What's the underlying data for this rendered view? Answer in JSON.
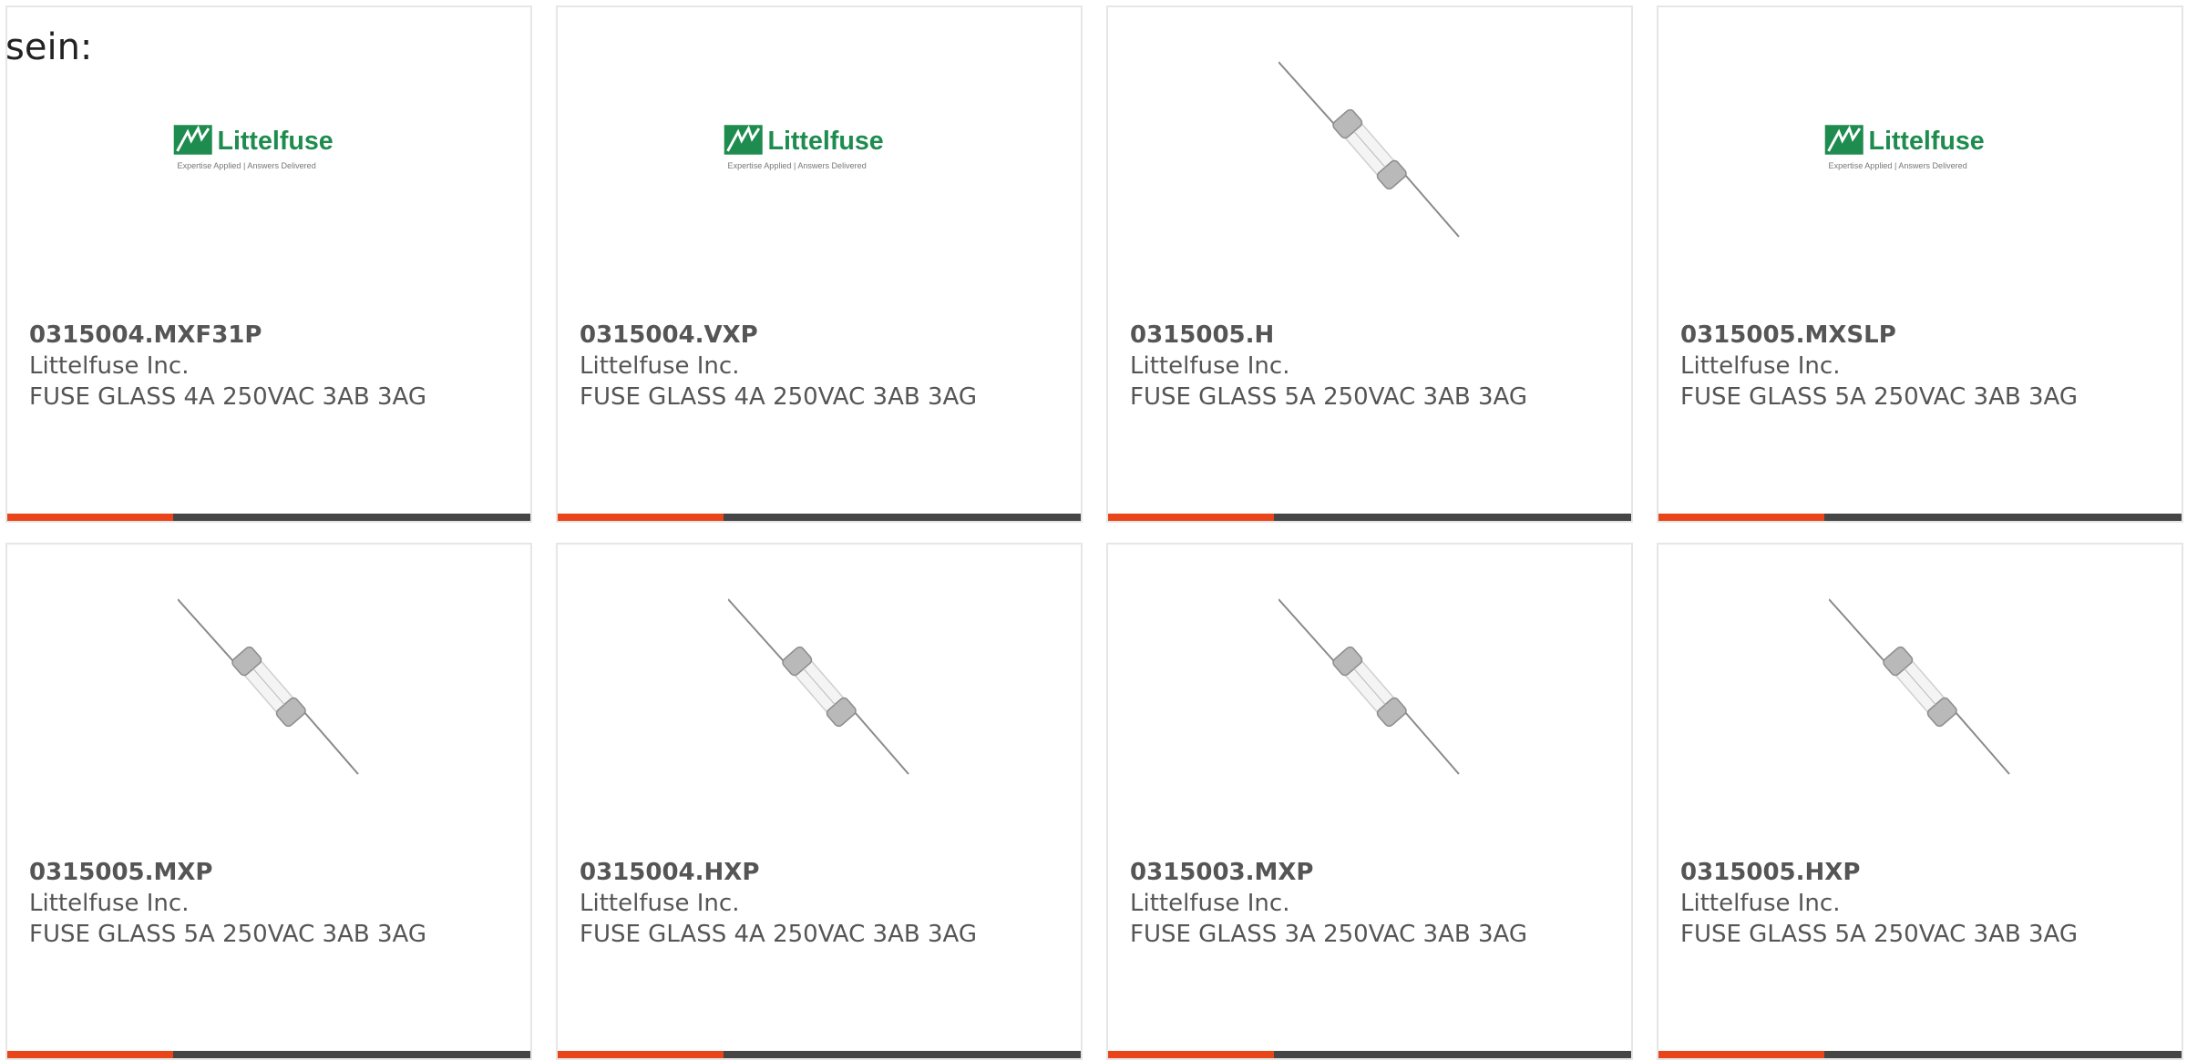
{
  "intro_text": "sein:",
  "logo": {
    "wordmark": "Littelfuse",
    "tagline": "Expertise Applied | Answers Delivered",
    "color": "#1e8c4e"
  },
  "accent_colors": {
    "bar_accent": "#e8461a",
    "bar_base": "#454545"
  },
  "products": [
    {
      "part_number": "0315004.MXF31P",
      "manufacturer": "Littelfuse Inc.",
      "description": "FUSE GLASS 4A 250VAC 3AB 3AG",
      "image": "logo"
    },
    {
      "part_number": "0315004.VXP",
      "manufacturer": "Littelfuse Inc.",
      "description": "FUSE GLASS 4A 250VAC 3AB 3AG",
      "image": "logo"
    },
    {
      "part_number": "0315005.H",
      "manufacturer": "Littelfuse Inc.",
      "description": "FUSE GLASS 5A 250VAC 3AB 3AG",
      "image": "fuse"
    },
    {
      "part_number": "0315005.MXSLP",
      "manufacturer": "Littelfuse Inc.",
      "description": "FUSE GLASS 5A 250VAC 3AB 3AG",
      "image": "logo"
    },
    {
      "part_number": "0315005.MXP",
      "manufacturer": "Littelfuse Inc.",
      "description": "FUSE GLASS 5A 250VAC 3AB 3AG",
      "image": "fuse"
    },
    {
      "part_number": "0315004.HXP",
      "manufacturer": "Littelfuse Inc.",
      "description": "FUSE GLASS 4A 250VAC 3AB 3AG",
      "image": "fuse"
    },
    {
      "part_number": "0315003.MXP",
      "manufacturer": "Littelfuse Inc.",
      "description": "FUSE GLASS 3A 250VAC 3AB 3AG",
      "image": "fuse"
    },
    {
      "part_number": "0315005.HXP",
      "manufacturer": "Littelfuse Inc.",
      "description": "FUSE GLASS 5A 250VAC 3AB 3AG",
      "image": "fuse"
    }
  ]
}
